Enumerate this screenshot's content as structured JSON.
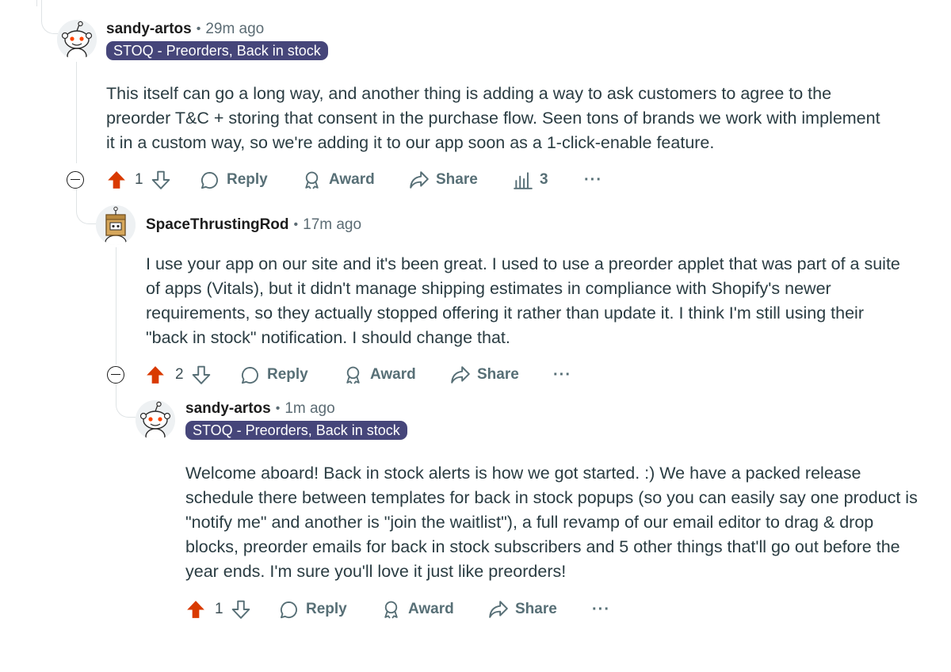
{
  "comments": [
    {
      "author": "sandy-artos",
      "time": "29m ago",
      "flair": "STOQ - Preorders, Back in stock",
      "body": "This itself can go a long way, and another thing is adding a way to ask customers to agree to the preorder T&C + storing that consent in the purchase flow. Seen tons of brands we work with implement it in a custom way, so we're adding it to our app soon as a 1-click-enable feature.",
      "score": "1",
      "views": "3",
      "actions": {
        "reply": "Reply",
        "award": "Award",
        "share": "Share",
        "more": "···"
      }
    },
    {
      "author": "SpaceThrustingRod",
      "time": "17m ago",
      "body": "I use your app on our site and it's been great. I used to use a preorder applet that was part of a suite of apps (Vitals), but it didn't manage shipping estimates in compliance with Shopify's newer requirements, so they actually stopped offering it rather than update it. I think I'm still using their \"back in stock\" notification. I should change that.",
      "score": "2",
      "actions": {
        "reply": "Reply",
        "award": "Award",
        "share": "Share",
        "more": "···"
      }
    },
    {
      "author": "sandy-artos",
      "time": "1m ago",
      "flair": "STOQ - Preorders, Back in stock",
      "body": "Welcome aboard! Back in stock alerts is how we got started. :) We have a packed release schedule there between templates for back in stock popups (so you can easily say one product is \"notify me\" and another is \"join the waitlist\"), a full revamp of our email editor to drag & drop blocks, preorder emails for back in stock subscribers and 5 other things that'll go out before the year ends. I'm sure you'll love it just like preorders!",
      "score": "1",
      "actions": {
        "reply": "Reply",
        "award": "Award",
        "share": "Share",
        "more": "···"
      }
    }
  ],
  "colors": {
    "upvote_active": "#d93a00",
    "flair_bg": "#46467a",
    "action_text": "#576f76",
    "thread_line": "#dfe3e5"
  },
  "icons": {
    "upvote": "upvote-arrow-icon",
    "downvote": "downvote-arrow-icon",
    "reply": "comment-bubble-icon",
    "award": "award-ribbon-icon",
    "share": "share-arrow-icon",
    "views": "bar-chart-icon",
    "collapse": "collapse-minus-icon",
    "more": "ellipsis-icon"
  }
}
